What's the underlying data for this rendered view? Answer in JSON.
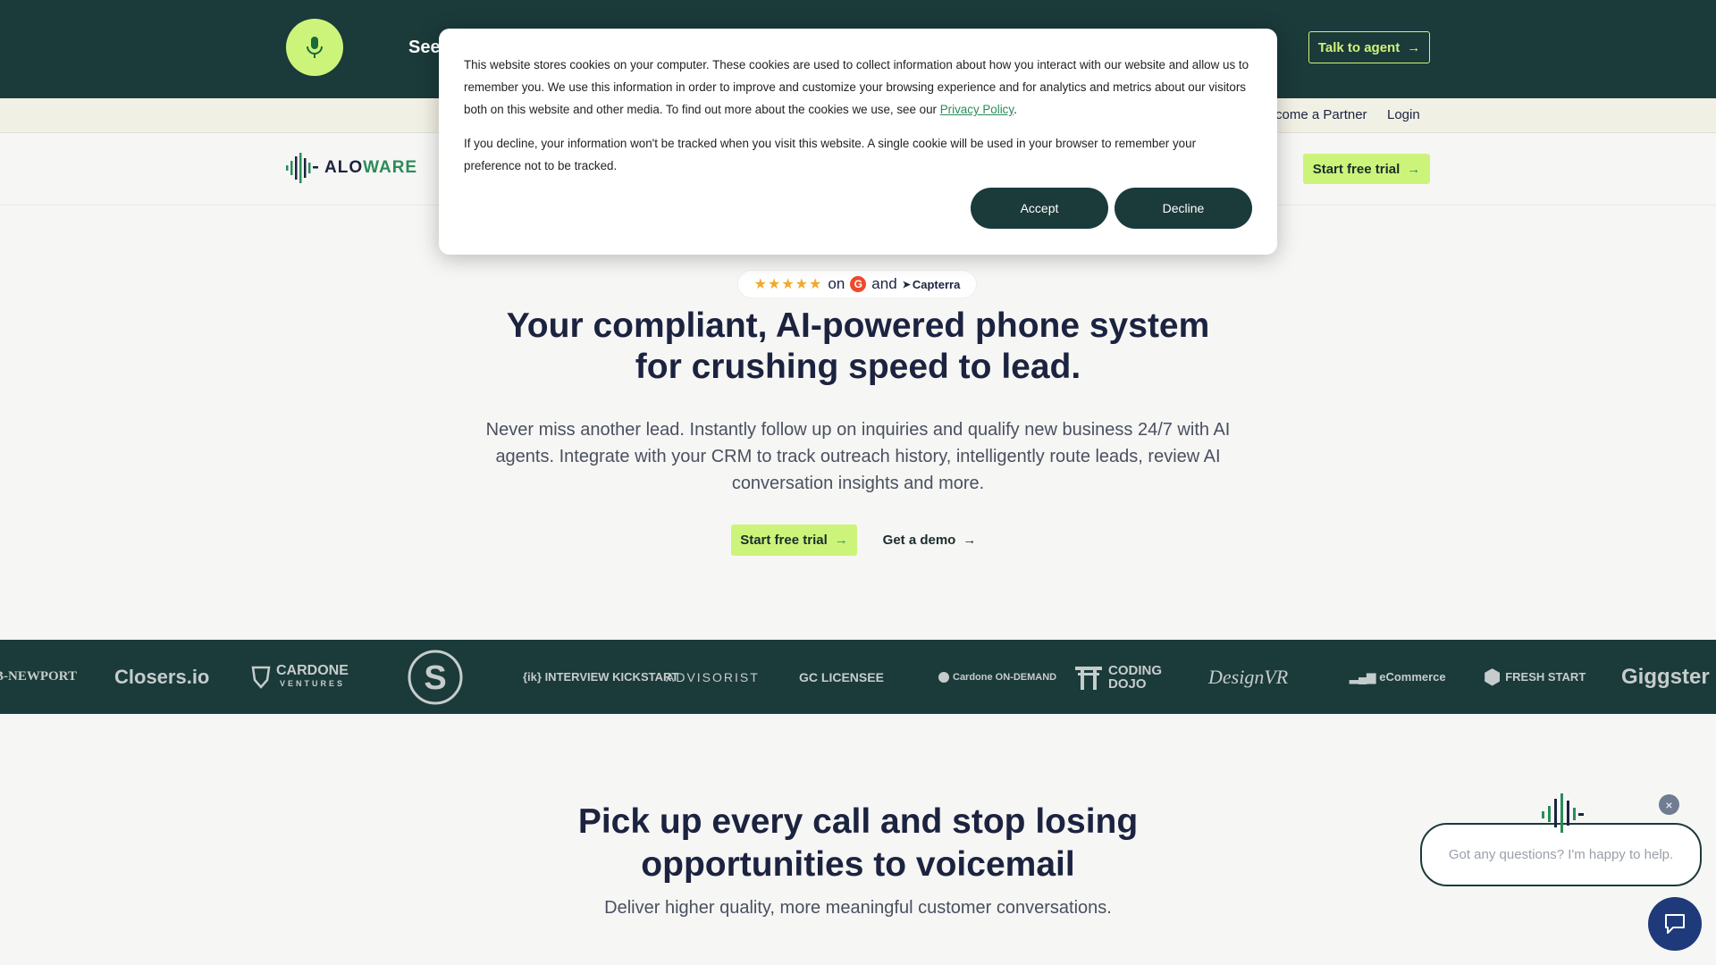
{
  "topbar": {
    "mic_icon": "microphone-icon",
    "text": "See",
    "talk_button": "Talk to agent",
    "accent": "#cdf47a",
    "background": "#1b3a3a"
  },
  "subnav": {
    "partner": "come a Partner",
    "login": "Login"
  },
  "mainnav": {
    "logo_prefix": "ALO",
    "logo_suffix": "WARE",
    "trial_button": "Start free trial"
  },
  "hero": {
    "stars": "★★★★★",
    "on": "on",
    "g2_mark": "G",
    "and": "and",
    "capterra": "Capterra",
    "title_line1": "Your compliant, AI-powered phone system",
    "title_line2": "for crushing speed to lead.",
    "subtitle": "Never miss another lead. Instantly follow up on inquiries and qualify new business 24/7 with AI agents. Integrate with your CRM to track outreach history, intelligently route leads, review AI conversation insights and more.",
    "trial_button": "Start free trial",
    "demo_button": "Get a demo"
  },
  "logos": [
    "B-NEWPORT",
    "Closers.io",
    "CARDONE",
    "S",
    "{ik} INTERVIEW KICKSTART",
    "ADVISORIST",
    "GC LICENSEE",
    "Cardone ON-DEMAND",
    "CODING DOJO",
    "DesignVR",
    "eCommerce",
    "FRESH START",
    "Giggster"
  ],
  "logo_sub": {
    "cardone": "VENTURES"
  },
  "section2": {
    "title_line1": "Pick up every call and stop losing",
    "title_line2": "opportunities to voicemail",
    "subtitle": "Deliver higher quality, more meaningful customer conversations."
  },
  "chat": {
    "placeholder": "Got any questions? I'm happy to help.",
    "close": "×"
  },
  "cookie": {
    "p1_before": "This website stores cookies on your computer. These cookies are used to collect information about how you interact with our website and allow us to remember you. We use this information in order to improve and customize your browsing experience and for analytics and metrics about our visitors both on this website and other media. To find out more about the cookies we use, see our ",
    "p1_link": "Privacy Policy",
    "p1_after": ".",
    "p2": "If you decline, your information won't be tracked when you visit this website. A single cookie will be used in your browser to remember your preference not to be tracked.",
    "accept": "Accept",
    "decline": "Decline"
  }
}
